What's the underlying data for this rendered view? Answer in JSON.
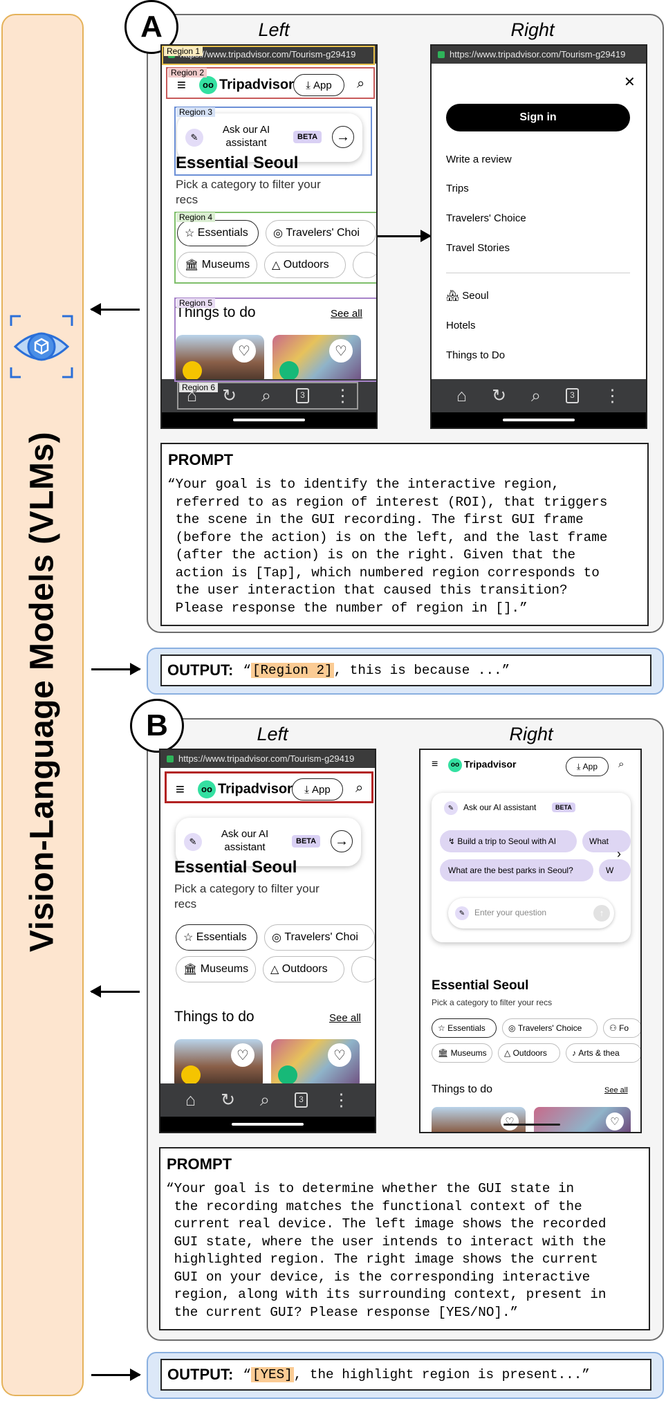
{
  "sidebar": {
    "label": "Vision-Language Models (VLMs)",
    "icon": "eye-scan-icon"
  },
  "panel_a": {
    "tag": "A",
    "left_title": "Left",
    "right_title": "Right",
    "left_phone": {
      "url": "https://www.tripadvisor.com/Tourism-g29419",
      "brand": "Tripadvisor",
      "app_button": "App",
      "ai_text": "Ask our AI assistant",
      "beta": "BETA",
      "heading": "Essential Seoul",
      "subheading": "Pick a category to filter your recs",
      "chips": [
        "Essentials",
        "Travelers' Choi",
        "Museums",
        "Outdoors"
      ],
      "section_title": "Things to do",
      "see_all": "See all",
      "tab_count": "3",
      "regions": [
        "Region 1",
        "Region 2",
        "Region 3",
        "Region 4",
        "Region 5",
        "Region 6"
      ]
    },
    "right_phone": {
      "url": "https://www.tripadvisor.com/Tourism-g29419",
      "close": "✕",
      "sign_in": "Sign in",
      "menu_items": [
        "Write a review",
        "Trips",
        "Travelers' Choice",
        "Travel Stories"
      ],
      "secondary_items": [
        "Seoul",
        "Hotels",
        "Things to Do"
      ],
      "tab_count": "3"
    },
    "prompt": {
      "title": "PROMPT",
      "text": "“Your goal is to identify the interactive region,\n referred to as region of interest (ROI), that triggers\n the scene in the GUI recording. The first GUI frame\n (before the action) is on the left, and the last frame\n (after the action) is on the right. Given that the\n action is [Tap], which numbered region corresponds to\n the user interaction that caused this transition?\n Please response the number of region in [].”"
    },
    "output": {
      "label": "OUTPUT:",
      "open_quote": "“",
      "highlight": "[Region 2]",
      "rest": ", this is because ...”"
    }
  },
  "panel_b": {
    "tag": "B",
    "left_title": "Left",
    "right_title": "Right",
    "left_phone": {
      "url": "https://www.tripadvisor.com/Tourism-g29419",
      "brand": "Tripadvisor",
      "app_button": "App",
      "ai_text": "Ask our AI assistant",
      "beta": "BETA",
      "heading": "Essential Seoul",
      "subheading": "Pick a category to filter your recs",
      "chips": [
        "Essentials",
        "Travelers' Choi",
        "Museums",
        "Outdoors"
      ],
      "section_title": "Things to do",
      "see_all": "See all",
      "tab_count": "3"
    },
    "right_phone": {
      "brand": "Tripadvisor",
      "app_button": "App",
      "ai_text": "Ask our AI assistant",
      "beta": "BETA",
      "suggestions": [
        "Build a trip to Seoul with AI",
        "What",
        "What are the best parks in Seoul?",
        "W"
      ],
      "input_placeholder": "Enter your question",
      "heading": "Essential Seoul",
      "subheading": "Pick a category to filter your recs",
      "chips": [
        "Essentials",
        "Travelers' Choice",
        "Fo",
        "Museums",
        "Outdoors",
        "Arts & thea"
      ],
      "section_title": "Things to do",
      "see_all": "See all"
    },
    "prompt": {
      "title": "PROMPT",
      "text": "“Your goal is to determine whether the GUI state in\n the recording matches the functional context of the\n current real device. The left image shows the recorded\n GUI state, where the user intends to interact with the\n highlighted region. The right image shows the current\n GUI on your device, is the corresponding interactive\n region, along with its surrounding context, present in\n the current GUI? Please response [YES/NO].”"
    },
    "output": {
      "label": "OUTPUT:",
      "open_quote": "“",
      "highlight": "[YES]",
      "rest": ", the highlight region is present...”"
    }
  },
  "colors": {
    "sidebar_fill": "#fde5cf",
    "sidebar_border": "#e5b25a",
    "eye_blue": "#2a6fd8",
    "region1": "#e8c04a",
    "region2": "#c85a5a",
    "region3": "#6b8fd6",
    "region4": "#7fbf6a",
    "region5": "#a783c9",
    "region6": "#9a9a9a",
    "target_border": "#b22222",
    "output_fill": "#dce8f8",
    "highlight": "#fbcb94",
    "ta_green": "#34e0a1"
  }
}
